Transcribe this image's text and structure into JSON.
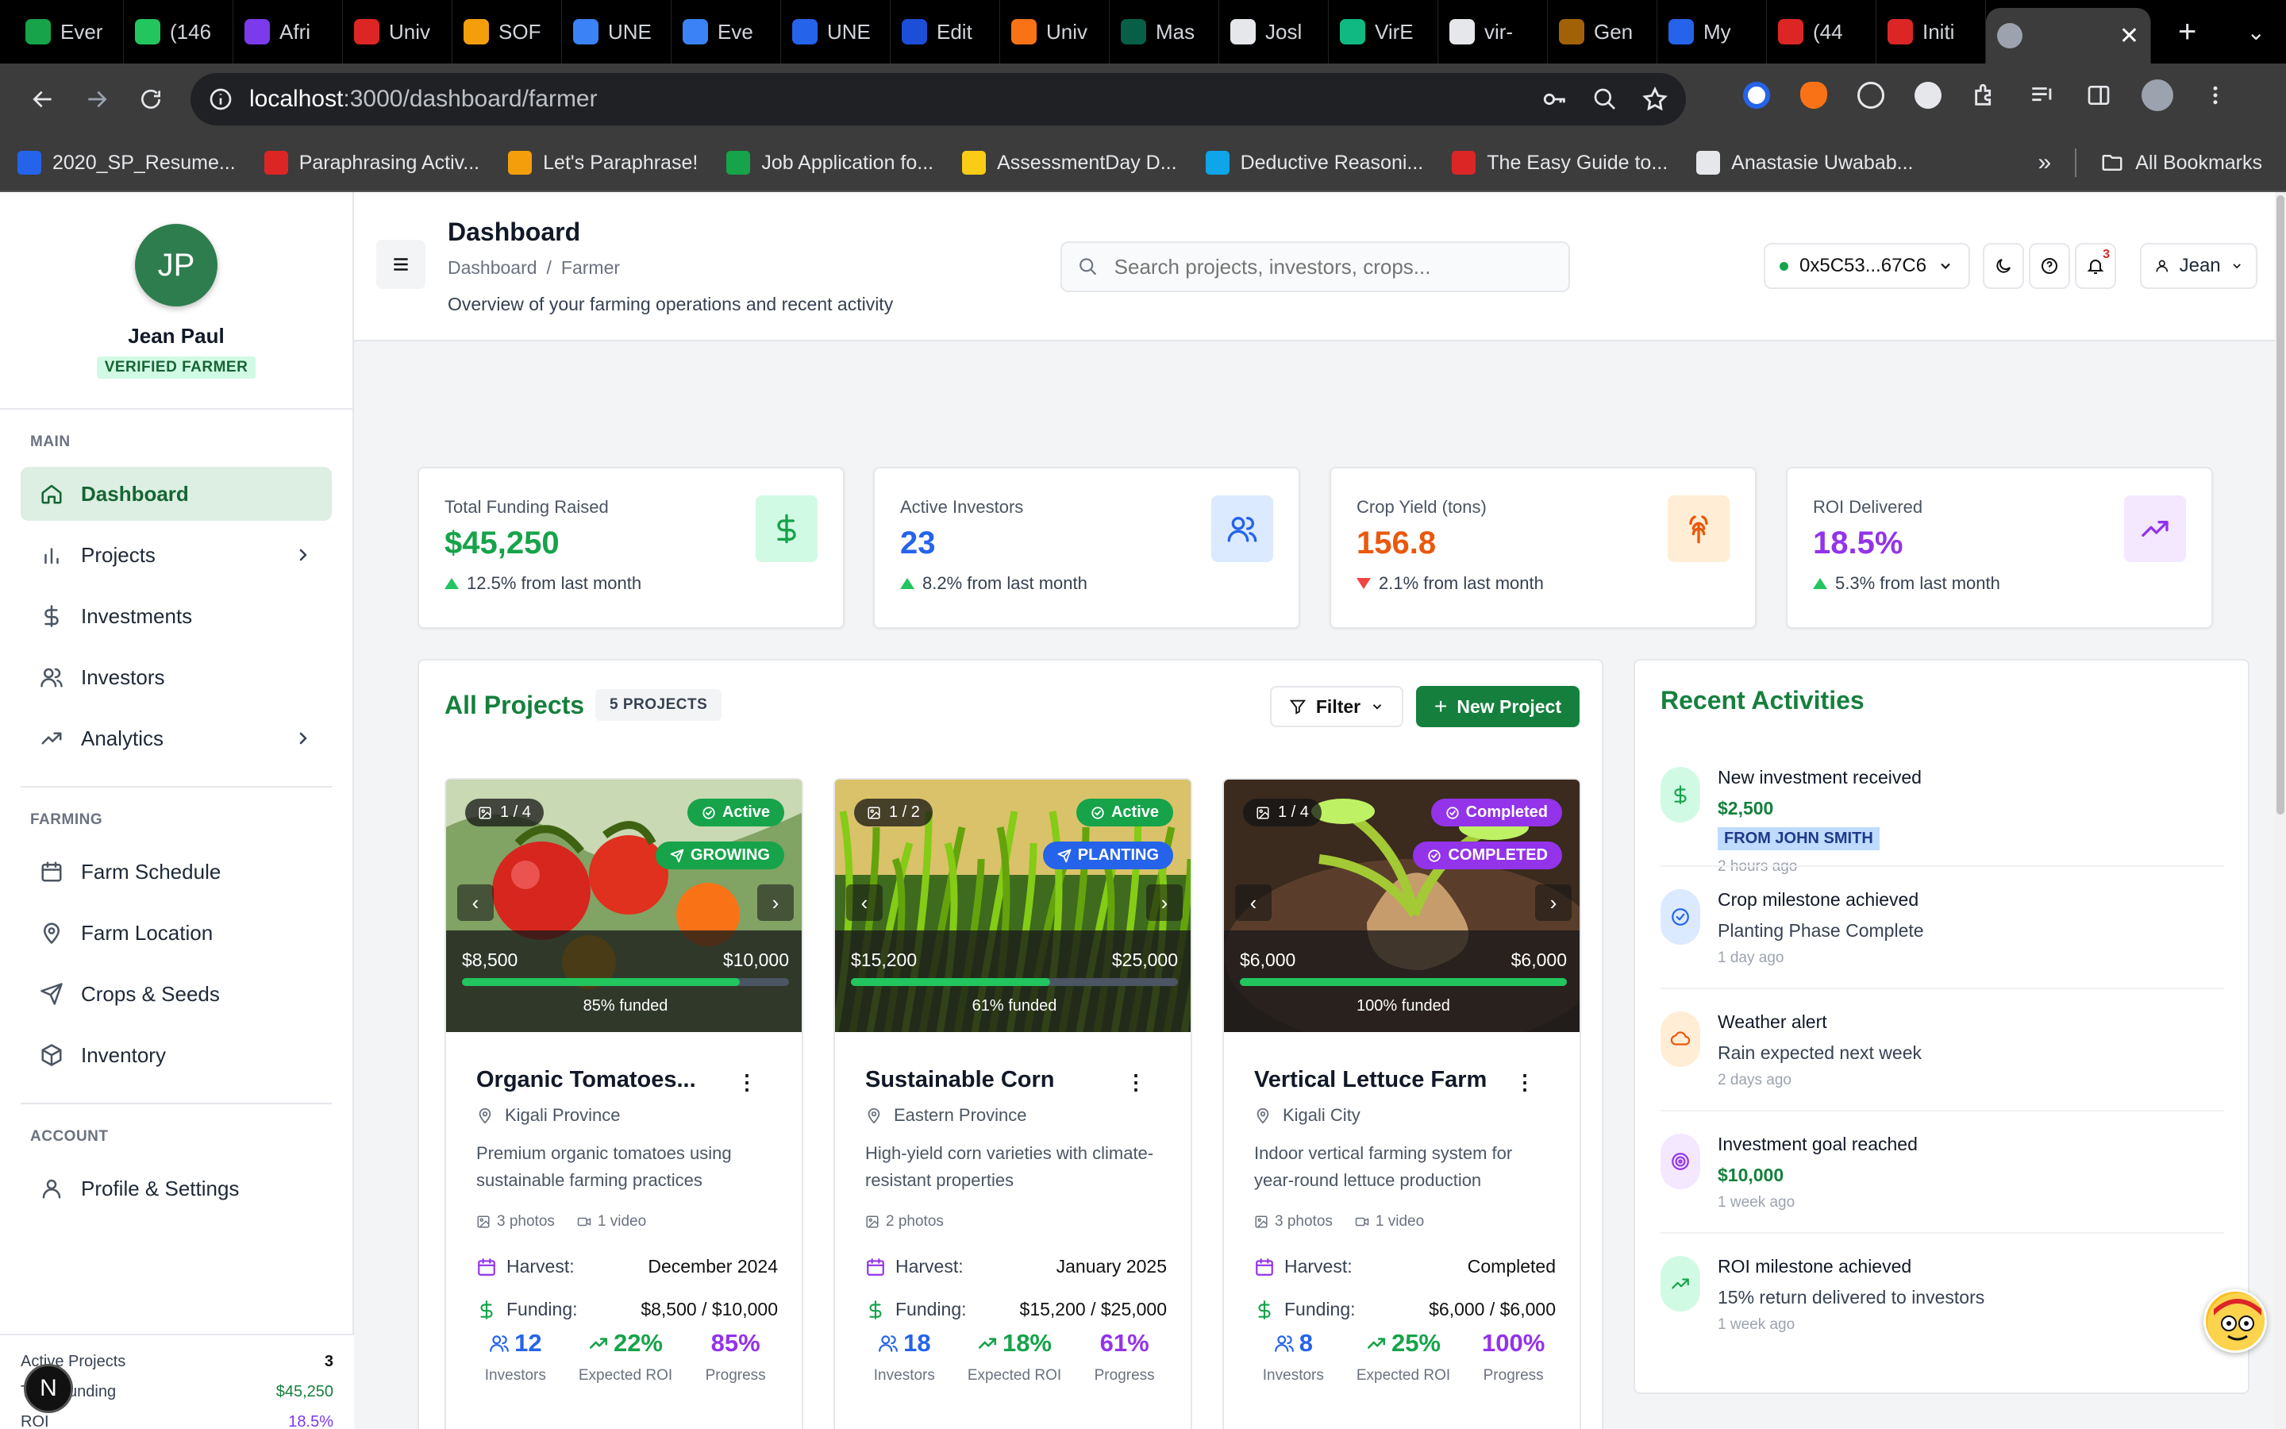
{
  "browser": {
    "tabs": [
      {
        "label": "Ever",
        "color": "#16a34a"
      },
      {
        "label": "(146",
        "color": "#22c55e"
      },
      {
        "label": "Afri",
        "color": "#7c3aed"
      },
      {
        "label": "Univ",
        "color": "#dc2626"
      },
      {
        "label": "SOF",
        "color": "#f59e0b"
      },
      {
        "label": "UNE",
        "color": "#3b82f6"
      },
      {
        "label": "Eve",
        "color": "#3b82f6"
      },
      {
        "label": "UNE",
        "color": "#2563eb"
      },
      {
        "label": "Edit",
        "color": "#1d4ed8"
      },
      {
        "label": "Univ",
        "color": "#f97316"
      },
      {
        "label": "Mas",
        "color": "#065f46"
      },
      {
        "label": "Josl",
        "color": "#e5e7eb"
      },
      {
        "label": "VirE",
        "color": "#10b981"
      },
      {
        "label": "vir-",
        "color": "#e5e7eb"
      },
      {
        "label": "Gen",
        "color": "#a16207"
      },
      {
        "label": "My",
        "color": "#2563eb"
      },
      {
        "label": "(44",
        "color": "#dc2626"
      },
      {
        "label": "Initi",
        "color": "#dc2626"
      }
    ],
    "active_tab_close": "✕",
    "new_tab": "+",
    "url_host": "localhost",
    "url_path": ":3000/dashboard/farmer",
    "bookmarks": [
      {
        "label": "2020_SP_Resume...",
        "color": "#2563eb"
      },
      {
        "label": "Paraphrasing Activ...",
        "color": "#dc2626"
      },
      {
        "label": "Let's Paraphrase!",
        "color": "#f59e0b"
      },
      {
        "label": "Job Application fo...",
        "color": "#16a34a"
      },
      {
        "label": "AssessmentDay D...",
        "color": "#facc15"
      },
      {
        "label": "Deductive Reasoni...",
        "color": "#0ea5e9"
      },
      {
        "label": "The Easy Guide to...",
        "color": "#dc2626"
      },
      {
        "label": "Anastasie Uwabab...",
        "color": "#e5e7eb"
      }
    ],
    "bookmarks_more": "»",
    "all_bookmarks": "All Bookmarks"
  },
  "profile": {
    "initials": "JP",
    "name": "Jean Paul",
    "badge": "VERIFIED FARMER"
  },
  "sidebar": {
    "sections": [
      {
        "title": "MAIN",
        "items": [
          {
            "label": "Dashboard",
            "icon": "home-icon",
            "active": true
          },
          {
            "label": "Projects",
            "icon": "bar-chart-icon",
            "chevron": true
          },
          {
            "label": "Investments",
            "icon": "dollar-icon"
          },
          {
            "label": "Investors",
            "icon": "users-icon"
          },
          {
            "label": "Analytics",
            "icon": "trending-up-icon",
            "chevron": true
          }
        ]
      },
      {
        "title": "FARMING",
        "items": [
          {
            "label": "Farm Schedule",
            "icon": "calendar-icon"
          },
          {
            "label": "Farm Location",
            "icon": "map-pin-icon"
          },
          {
            "label": "Crops & Seeds",
            "icon": "send-icon"
          },
          {
            "label": "Inventory",
            "icon": "package-icon"
          }
        ]
      },
      {
        "title": "ACCOUNT",
        "items": [
          {
            "label": "Profile & Settings",
            "icon": "user-icon"
          }
        ]
      }
    ],
    "stats": [
      {
        "label": "Active Projects",
        "value": "3"
      },
      {
        "label": "Total Funding",
        "value": "$45,250"
      },
      {
        "label": "ROI",
        "value": "18.5%"
      }
    ],
    "fab_letter": "N"
  },
  "header": {
    "title": "Dashboard",
    "breadcrumb": [
      "Dashboard",
      "Farmer"
    ],
    "breadcrumb_sep": "/",
    "subtitle": "Overview of your farming operations and recent activity",
    "search_placeholder": "Search projects, investors, crops...",
    "wallet": "0x5C53...67C6",
    "notifications": "3",
    "user": "Jean"
  },
  "stats": [
    {
      "label": "Total Funding Raised",
      "value": "$45,250",
      "change": "12.5% from last month",
      "trend": "up",
      "color": "#16a34a",
      "icon_bg": "#d1fae5",
      "icon": "dollar-icon"
    },
    {
      "label": "Active Investors",
      "value": "23",
      "change": "8.2% from last month",
      "trend": "up",
      "color": "#2563eb",
      "icon_bg": "#dbeafe",
      "icon": "users-icon"
    },
    {
      "label": "Crop Yield (tons)",
      "value": "156.8",
      "change": "2.1% from last month",
      "trend": "down",
      "color": "#ea580c",
      "icon_bg": "#ffedd5",
      "icon": "wheat-icon"
    },
    {
      "label": "ROI Delivered",
      "value": "18.5%",
      "change": "5.3% from last month",
      "trend": "up",
      "color": "#9333ea",
      "icon_bg": "#f3e8ff",
      "icon": "trending-up-icon"
    }
  ],
  "projects": {
    "title": "All Projects",
    "count": "5 PROJECTS",
    "filter_label": "Filter",
    "new_label": "New Project",
    "cards": [
      {
        "name": "Organic Tomatoes...",
        "location": "Kigali Province",
        "description": "Premium organic tomatoes using sustainable farming practices",
        "image_index": "1 / 4",
        "status": "Active",
        "stage": "GROWING",
        "status_color": "#16a34a",
        "stage_color": "#16a34a",
        "raised": "$8,500",
        "goal": "$10,000",
        "funded_pct": 0.85,
        "funded_label": "85% funded",
        "photos": "3 photos",
        "video": "1 video",
        "harvest_label": "Harvest:",
        "harvest": "December 2024",
        "funding_label": "Funding:",
        "funding": "$8,500 / $10,000",
        "investors": "12",
        "roi": "22%",
        "progress": "85%",
        "theme": "tomato"
      },
      {
        "name": "Sustainable Corn",
        "location": "Eastern Province",
        "description": "High-yield corn varieties with climate-resistant properties",
        "image_index": "1 / 2",
        "status": "Active",
        "stage": "PLANTING",
        "status_color": "#16a34a",
        "stage_color": "#2563eb",
        "raised": "$15,200",
        "goal": "$25,000",
        "funded_pct": 0.61,
        "funded_label": "61% funded",
        "photos": "2 photos",
        "video": "",
        "harvest_label": "Harvest:",
        "harvest": "January 2025",
        "funding_label": "Funding:",
        "funding": "$15,200 / $25,000",
        "investors": "18",
        "roi": "18%",
        "progress": "61%",
        "theme": "corn"
      },
      {
        "name": "Vertical Lettuce Farm",
        "location": "Kigali City",
        "description": "Indoor vertical farming system for year-round lettuce production",
        "image_index": "1 / 4",
        "status": "Completed",
        "stage": "COMPLETED",
        "status_color": "#9333ea",
        "stage_color": "#9333ea",
        "raised": "$6,000",
        "goal": "$6,000",
        "funded_pct": 1.0,
        "funded_label": "100% funded",
        "photos": "3 photos",
        "video": "1 video",
        "harvest_label": "Harvest:",
        "harvest": "Completed",
        "funding_label": "Funding:",
        "funding": "$6,000 / $6,000",
        "investors": "8",
        "roi": "25%",
        "progress": "100%",
        "theme": "soil"
      }
    ],
    "footer_labels": [
      "Investors",
      "Expected ROI",
      "Progress"
    ]
  },
  "activities": {
    "title": "Recent Activities",
    "items": [
      {
        "title": "New investment received",
        "detail": "$2,500",
        "detail_style": "green",
        "tag": "FROM JOHN SMITH",
        "time": "2 hours ago",
        "icon": "dollar-icon",
        "color": "#16a34a",
        "bg": "#d1fae5"
      },
      {
        "title": "Crop milestone achieved",
        "detail": "Planting Phase Complete",
        "detail_style": "plain",
        "tag": "",
        "time": "1 day ago",
        "icon": "check-circle-icon",
        "color": "#2563eb",
        "bg": "#dbeafe"
      },
      {
        "title": "Weather alert",
        "detail": "Rain expected next week",
        "detail_style": "plain",
        "tag": "",
        "time": "2 days ago",
        "icon": "cloud-icon",
        "color": "#ea580c",
        "bg": "#ffedd5"
      },
      {
        "title": "Investment goal reached",
        "detail": "$10,000",
        "detail_style": "green",
        "tag": "",
        "time": "1 week ago",
        "icon": "target-icon",
        "color": "#9333ea",
        "bg": "#f3e8ff"
      },
      {
        "title": "ROI milestone achieved",
        "detail": "15% return delivered to investors",
        "detail_style": "plain",
        "tag": "",
        "time": "1 week ago",
        "icon": "trending-up-icon",
        "color": "#16a34a",
        "bg": "#d1fae5"
      }
    ]
  }
}
